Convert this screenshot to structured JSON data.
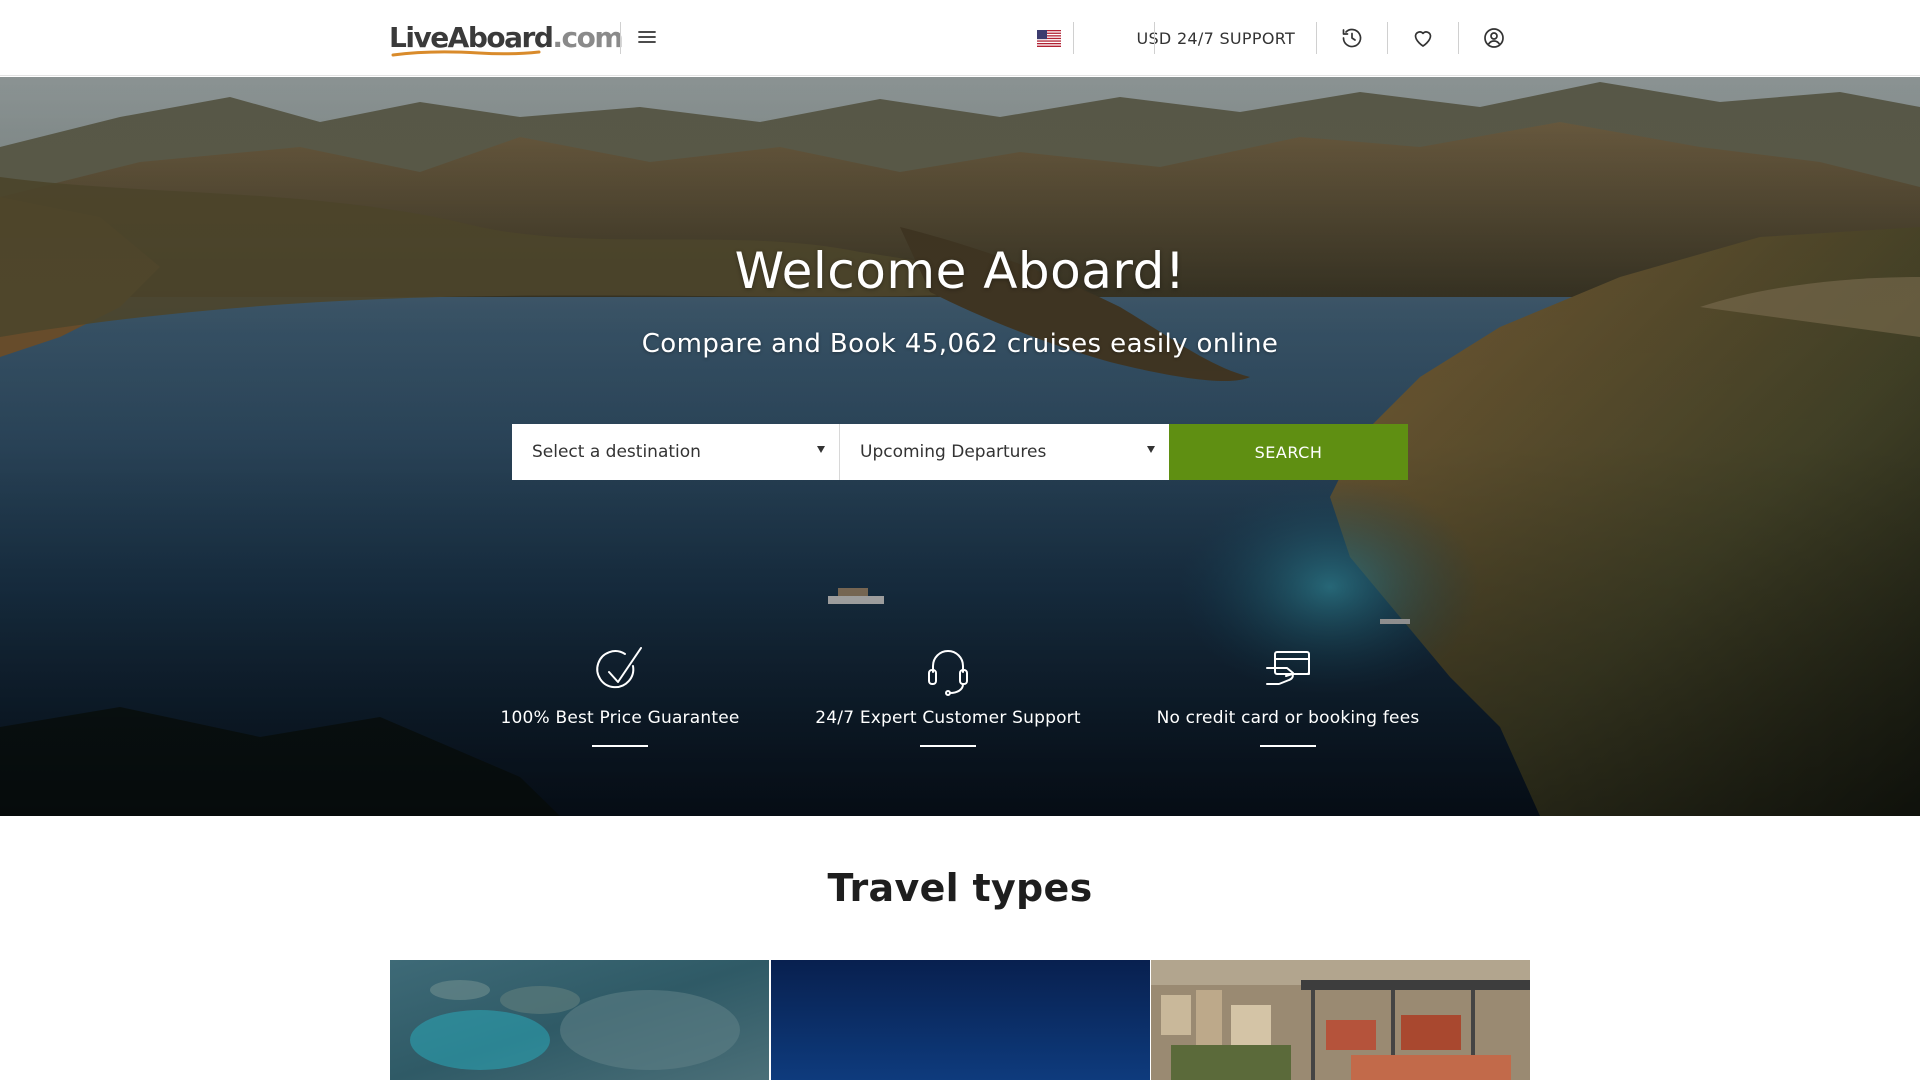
{
  "header": {
    "logo_brand": "LiveAboard",
    "logo_tld": ".com",
    "menu_icon": "hamburger-icon",
    "flag_icon": "us-flag-icon",
    "currency": "USD",
    "support": "24/7 SUPPORT",
    "history_icon": "history-icon",
    "wishlist_icon": "heart-icon",
    "account_icon": "user-circle-icon"
  },
  "hero": {
    "title": "Welcome Aboard!",
    "subtitle": "Compare and Book 45,062 cruises easily online",
    "search": {
      "destination_value": "Select a destination",
      "departures_value": "Upcoming Departures",
      "button_label": "SEARCH"
    },
    "usps": [
      {
        "icon": "checkmark-circle-icon",
        "label": "100% Best Price Guarantee"
      },
      {
        "icon": "headset-icon",
        "label": "24/7 Expert Customer Support"
      },
      {
        "icon": "credit-card-icon",
        "label": "No credit card or booking fees"
      }
    ]
  },
  "travel_types": {
    "title": "Travel types"
  },
  "colors": {
    "accent_green": "#5f8f12",
    "header_bg": "#ffffff",
    "text_dark": "#1e1e1e"
  }
}
